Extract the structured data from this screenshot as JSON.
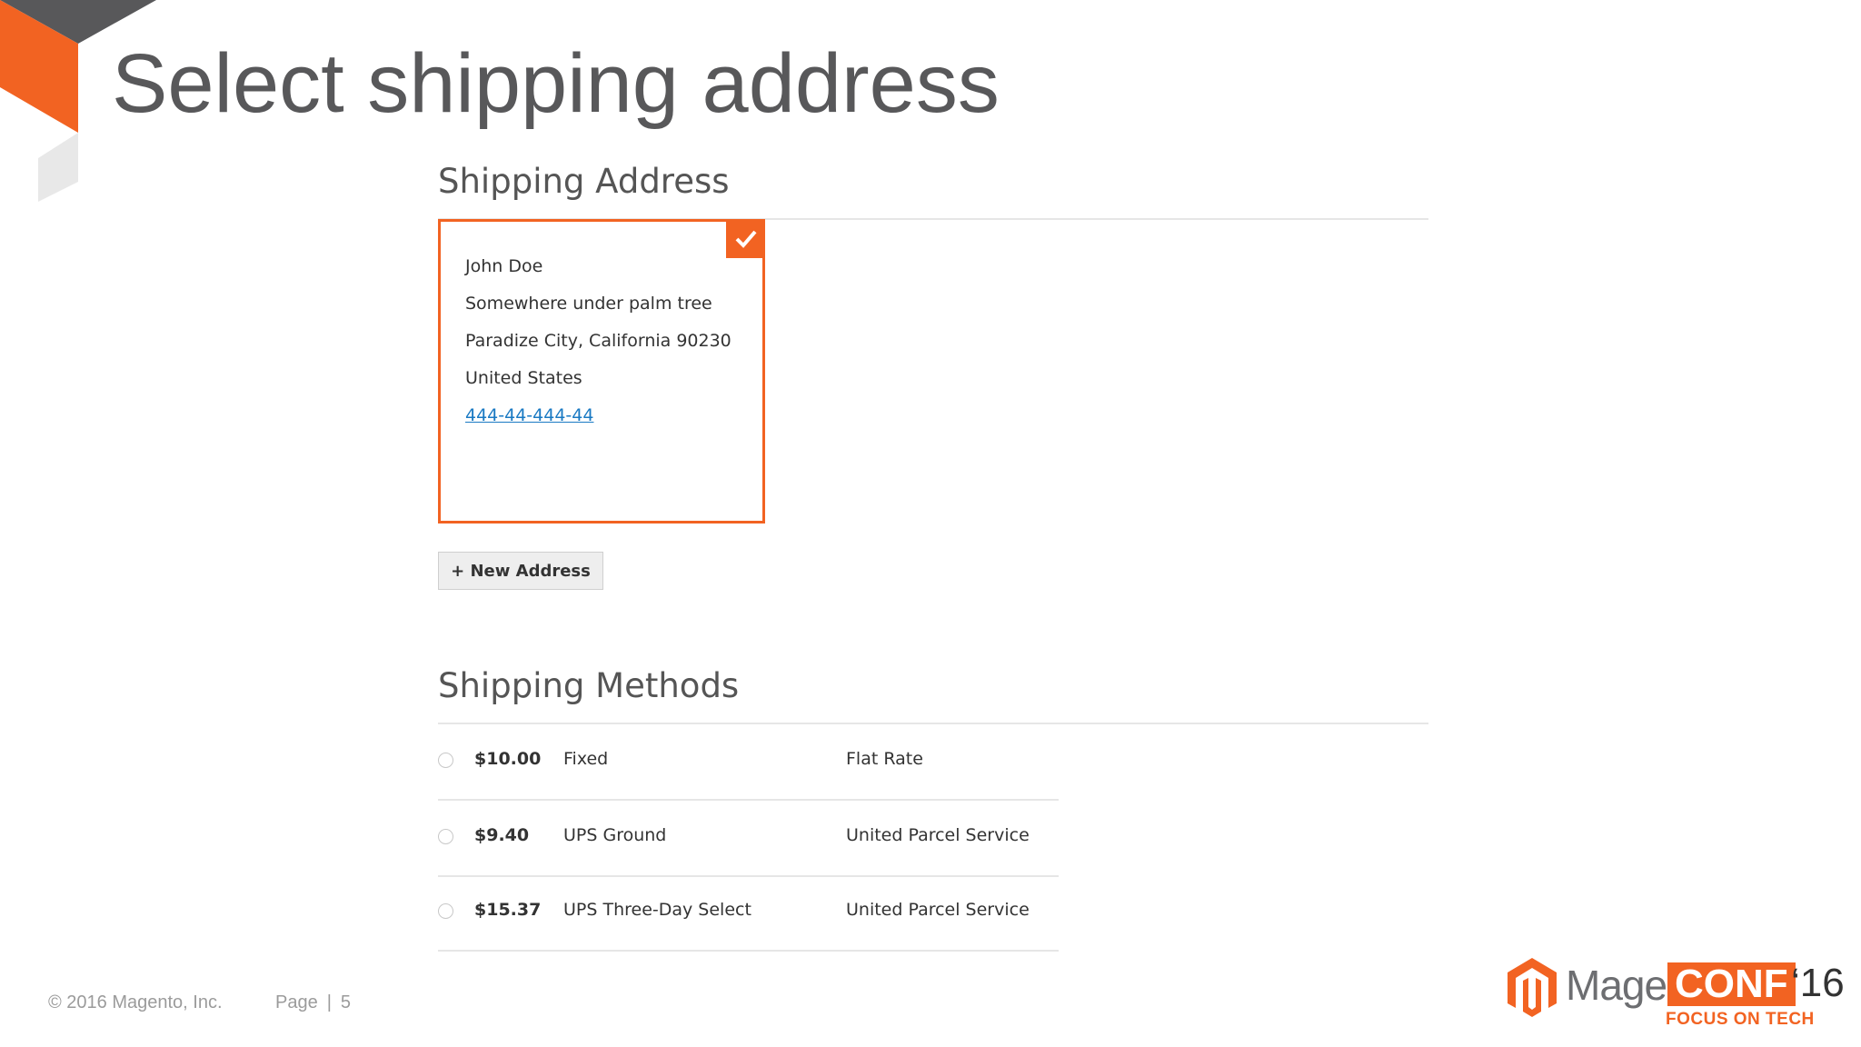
{
  "slide": {
    "title": "Select shipping address"
  },
  "shipping_address": {
    "heading": "Shipping Address",
    "card": {
      "name": "John Doe",
      "street": "Somewhere under palm tree",
      "city_line": "Paradize City, California 90230",
      "country": "United States",
      "phone": "444-44-444-44",
      "selected": true
    },
    "new_address_label": "+ New Address"
  },
  "shipping_methods": {
    "heading": "Shipping Methods",
    "rows": [
      {
        "price": "$10.00",
        "method": "Fixed",
        "carrier": "Flat Rate"
      },
      {
        "price": "$9.40",
        "method": "UPS Ground",
        "carrier": "United Parcel Service"
      },
      {
        "price": "$15.37",
        "method": "UPS Three-Day Select",
        "carrier": "United Parcel Service"
      }
    ]
  },
  "footer": {
    "copyright": "© 2016 Magento, Inc.",
    "page_label": "Page",
    "page_separator": "|",
    "page_number": "5"
  },
  "logo": {
    "mage": "Mage",
    "conf": "CONF",
    "year": "‘16",
    "tagline": "FOCUS ON TECH"
  },
  "colors": {
    "accent": "#f26322",
    "title_gray": "#58585a",
    "link_blue": "#1979c3"
  }
}
